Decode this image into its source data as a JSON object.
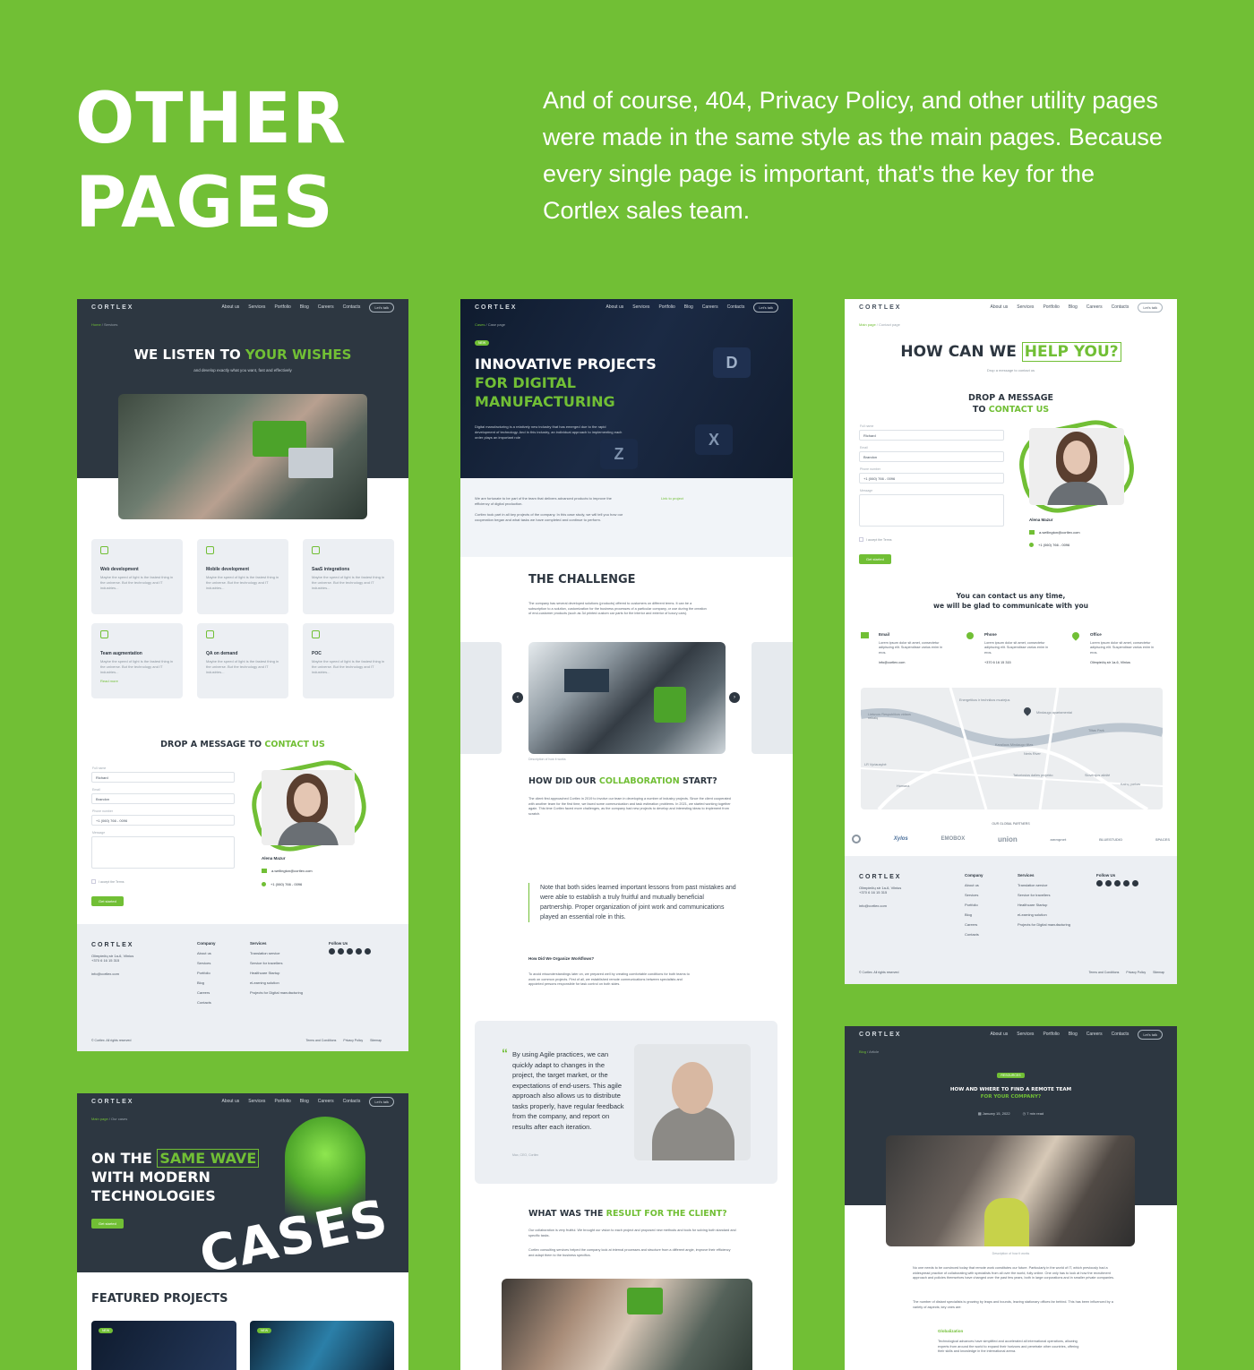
{
  "hero": {
    "title_line1": "OTHER",
    "title_line2": "PAGES",
    "description": "And of course, 404, Privacy Policy, and other utility pages were made in the same style as the main pages. Because every single page is important, that's the key for the Cortlex sales team."
  },
  "nav": {
    "logo": "CORTLEX",
    "items": [
      "About us",
      "Services",
      "Portfolio",
      "Blog",
      "Careers",
      "Contacts"
    ],
    "cta": "Let's talk"
  },
  "services_page": {
    "crumb_home": "Home",
    "crumb_current": "Services",
    "title_a": "WE LISTEN TO ",
    "title_b": "YOUR WISHES",
    "subtitle": "and develop exactly what you want, fast and effectively",
    "tiles": [
      {
        "title": "Web development",
        "text": "Maybe the speed of light is the fastest thing in the universe. But the technology and IT industries..."
      },
      {
        "title": "Mobile development",
        "text": "Maybe the speed of light is the fastest thing in the universe. But the technology and IT industries..."
      },
      {
        "title": "SaaS integrations",
        "text": "Maybe the speed of light is the fastest thing in the universe. But the technology and IT industries..."
      },
      {
        "title": "Team augmentation",
        "text": "Maybe the speed of light is the fastest thing in the universe. But the technology and IT industries..."
      },
      {
        "title": "QA on demand",
        "text": "Maybe the speed of light is the fastest thing in the universe. But the technology and IT industries..."
      },
      {
        "title": "POC",
        "text": "Maybe the speed of light is the fastest thing in the universe. But the technology and IT industries..."
      }
    ],
    "read_more": "Read more",
    "form_title_a": "DROP A MESSAGE TO ",
    "form_title_b": "CONTACT US",
    "field_name_label": "Full name",
    "field_name": "Richard",
    "field_email_label": "Email",
    "field_email": "Brandon",
    "field_phone_label": "Phone number",
    "field_phone": "+1 (060) 766 - 0096",
    "field_message_label": "Message",
    "terms": "I accept the Terms",
    "submit": "Get started",
    "person_name": "Alena Mazur",
    "person_email": "a.wellington@cortlex.com",
    "person_phone": "+1 (060) 766 - 0096"
  },
  "footer": {
    "logo": "CORTLEX",
    "address1": "Olimpiečių str 1a-6, Vilnius",
    "address2": "+370 6 16 15 315",
    "email": "info@cortlex.com",
    "company_label": "Company",
    "company_items": [
      "About us",
      "Services",
      "Portfolio",
      "Blog",
      "Careers",
      "Contacts"
    ],
    "services_label": "Services",
    "services_items": [
      "Translation service",
      "Service for travellers",
      "Healthcare Startup",
      "eLearning solution",
      "Projects for Digital manufacturing"
    ],
    "follow_label": "Follow Us",
    "copyright": "© Cortlex. All rights reserved",
    "terms": "Terms and Conditions",
    "privacy": "Privacy Policy",
    "sitemap": "Sitemap"
  },
  "case_page": {
    "crumb_home": "Cases",
    "crumb_current": "Case page",
    "badge": "NEW",
    "title_a": "INNOVATIVE PROJECTS",
    "title_b": "FOR DIGITAL",
    "title_c": "MANUFACTURING",
    "intro": "Digital manufacturing is a relatively new industry that has emerged due to the rapid development of technology. And in this industry, an individual approach to implementing each order plays an important role",
    "fortunate": "We are fortunate to be part of the team that delivers advanced products to improve the efficiency of digital production.",
    "cortlex_took": "Cortlex took part in all key projects of the company. In this case study, we will tell you how our cooperation began and what tasks we have completed and continue to perform.",
    "link": "Link to project",
    "challenge": "THE CHALLENGE",
    "challenge_text": "The company has several developed solutions (products) offered to customers on different terms. It can be a subscription to a solution, customization for the business processes of a particular company, or use during the creation of end-customer products (such as 3d printed custom car parts for the interior and exterior of luxury cars).",
    "photo_caption": "Description of how it works",
    "collab_a": "HOW DID OUR ",
    "collab_b": "COLLABORATION",
    "collab_c": " START?",
    "collab_text": "The client first approached Cortlex in 2019 to involve our team in developing a number of industry projects. Since the client cooperated with another team for the first time, we faced some communication and task estimation problems. In 2021, we started working together again. This time Cortlex faced more challenges, as the company had new projects to develop and interesting ideas to implement from scratch.",
    "quote": "Note that both sides learned important lessons from past mistakes and were able to establish a truly fruitful and mutually beneficial partnership. Proper organization of joint work and communications played an essential role in this.",
    "workflows": "How Did We Organize Workflows?",
    "workflows_text": "To avoid misunderstandings later on, we prepared well by creating comfortable conditions for both teams to work on common projects. First of all, we established remote communications between specialists and appointed persons responsible for task control on both sides.",
    "testimonial": "By using Agile practices, we can quickly adapt to changes in the project, the target market, or the expectations of end-users. This agile approach also allows us to distribute tasks properly, have regular feedback from the company, and report on results after each iteration.",
    "testimonial_author": "Max, CEO, Cortlex",
    "result_a": "WHAT WAS THE ",
    "result_b": "RESULT FOR THE CLIENT?",
    "result_text": "Our collaboration is very fruitful. We brought our vision to each project and proposed new methods and tools for solving both standard and specific tasks.",
    "result_text2": "Cortlex consulting services helped the company look at internal processes and structure from a different angle, improve their efficiency and adapt them to the business specifics."
  },
  "contact_page": {
    "crumb_home": "Main page",
    "crumb_current": "Contact page",
    "title_a": "HOW CAN WE ",
    "title_b": "HELP YOU?",
    "subtitle": "Drop a message to contact us",
    "form_title_a": "DROP A MESSAGE",
    "form_title_b": "TO ",
    "form_title_c": "CONTACT US",
    "contact_line1": "You can contact us any time,",
    "contact_line2": "we will be glad to communicate with you",
    "email_label": "Email",
    "phone_label": "Phone",
    "office_label": "Office",
    "lorem": "Lorem ipsum dolor sit amet, consectetur adipiscing elit. Suspendisse varius enim in eros.",
    "email_value": "info@cortlex.com",
    "phone_value": "+370 6 16 15 315",
    "office_value": "Olimpiečių str 1a-6, Vilnius",
    "partners_label": "OUR GLOBAL PARTNERS",
    "partners": [
      "Xylos",
      "EMOBOX",
      "union",
      "ammpnet",
      "BLUESTUDIO",
      "SPACES"
    ],
    "map_labels": [
      "Neris River",
      "Mindaugo apartamentai",
      "Karaliaus Mindaugo tiltas",
      "Lietuvos Respublikos vidaus reikalų",
      "Energetikos ir technikos muziejus",
      "Tiltas Park",
      "Humana",
      "Takoriosios dalies projekto",
      "Slovėnijos aikštė",
      "Kalnų parkas",
      "LR Vyriausybė"
    ]
  },
  "cases_page": {
    "crumb_home": "Main page",
    "crumb_current": "Our cases",
    "title_a": "ON THE ",
    "title_b": "SAME WAVE",
    "title_c": "WITH MODERN",
    "title_d": "TECHNOLOGIES",
    "cta": "Get started",
    "big_word": "CASES",
    "featured": "FEATURED PROJECTS",
    "badge": "NEW"
  },
  "article_page": {
    "crumb_home": "Blog",
    "crumb_current": "Article",
    "badge": "RESOURCES",
    "title_a": "HOW AND WHERE TO FIND A REMOTE TEAM",
    "title_b": "FOR YOUR COMPANY?",
    "date": "January 15, 2022",
    "read_time": "7 min read",
    "caption": "Description of how it works",
    "body1": "No one needs to be convinced today that remote work constitutes our future. Particularly in the world of IT, which previously had a widespread practice of collaborating with specialists from all over the world, fully online. One only has to look at how the recruitment approach and policies themselves have changed over the past few years, both in large corporations and in smaller private companies.",
    "body2": "The number of distant specialists is growing by leaps and bounds, leaving stationary offices far behind. This has been influenced by a variety of aspects; key ones are:",
    "section": "Globalization",
    "body3": "Technological advances have simplified and accelerated all international operations, allowing experts from around the world to expand their horizons and penetrate other countries, offering their skills and knowledge in the international arena."
  }
}
